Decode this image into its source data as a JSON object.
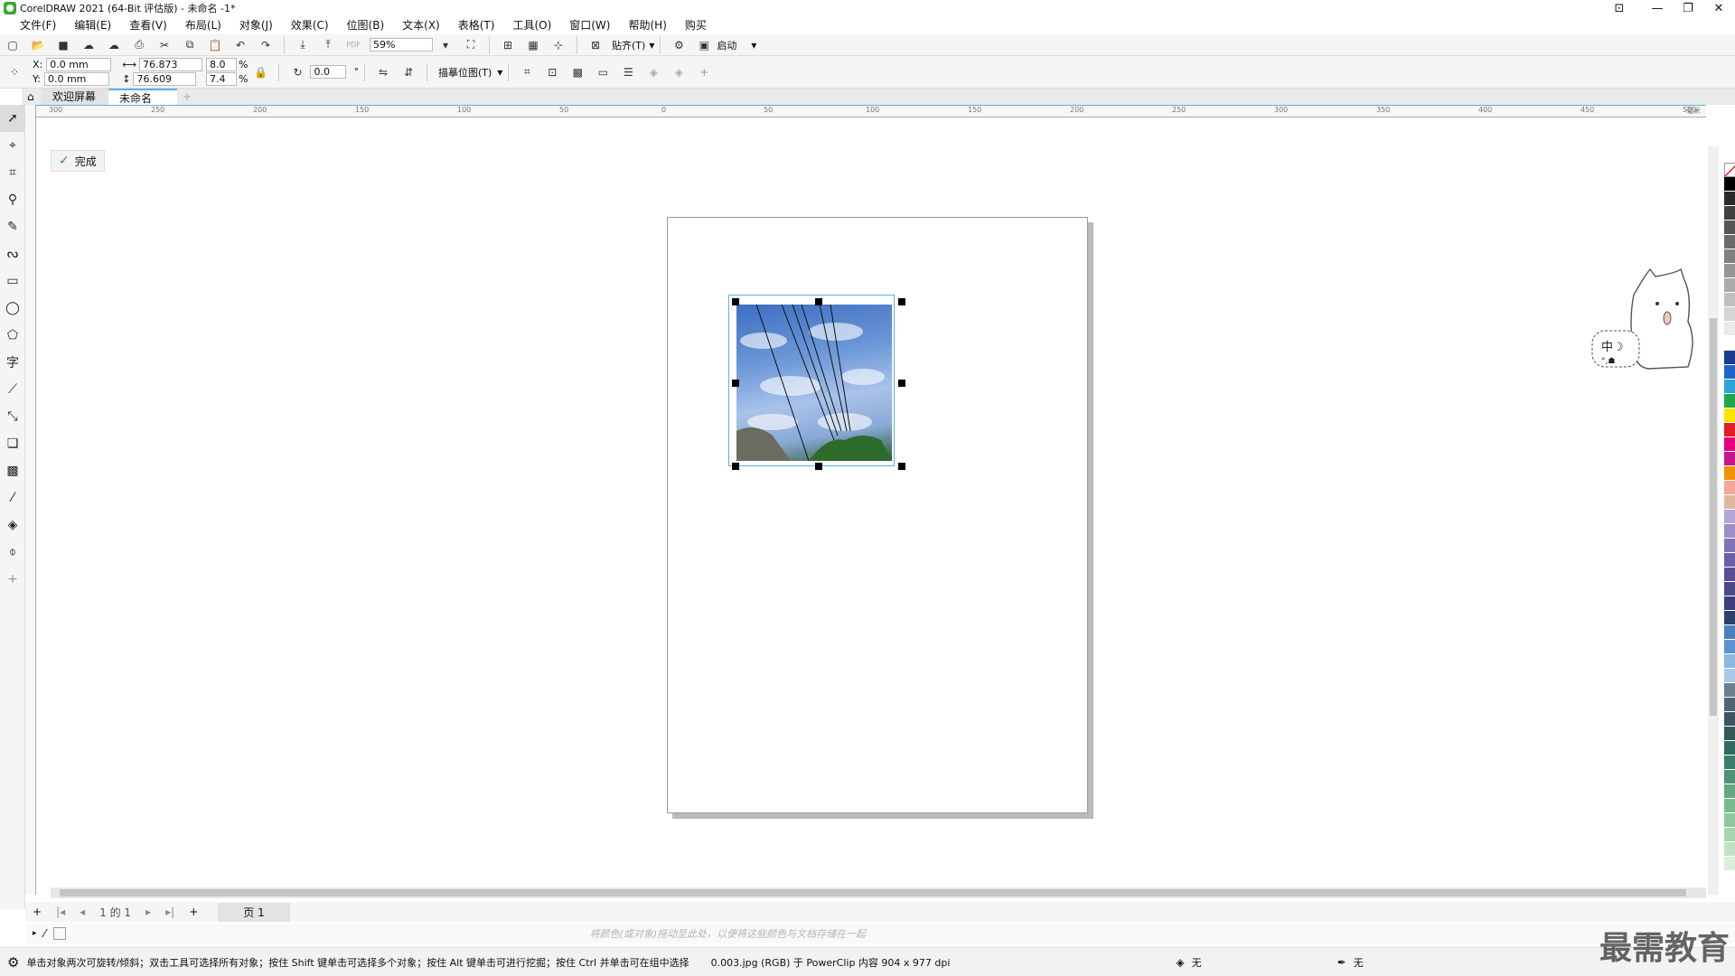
{
  "window": {
    "title": "CorelDRAW 2021 (64-Bit 评估版) - 未命名 -1*"
  },
  "menu": [
    "文件(F)",
    "编辑(E)",
    "查看(V)",
    "布局(L)",
    "对象(J)",
    "效果(C)",
    "位图(B)",
    "文本(X)",
    "表格(T)",
    "工具(O)",
    "窗口(W)",
    "帮助(H)",
    "购买"
  ],
  "standard": {
    "zoom": "59%",
    "snap_label": "贴齐(T)",
    "launch_label": "启动"
  },
  "props": {
    "x_label": "X:",
    "y_label": "Y:",
    "x": "0.0 mm",
    "y": "0.0 mm",
    "width": "76.873 mm",
    "height": "76.609 mm",
    "scale_w": "8.0",
    "scale_h": "7.4",
    "percent": "%",
    "rotation": "0.0",
    "degree": "°",
    "trace_label": "描摹位图(T)"
  },
  "tabs": {
    "home": "欢迎屏幕",
    "doc": "未命名 -1*",
    "add": "+"
  },
  "hruler": [
    "300",
    "250",
    "200",
    "150",
    "100",
    "50",
    "0",
    "50",
    "100",
    "150",
    "200",
    "250",
    "300",
    "350",
    "400",
    "450",
    "500"
  ],
  "hruler_unit": "毫米",
  "done_label": "完成",
  "pagenav": {
    "of": "1 的 1",
    "page_tab": "页 1"
  },
  "colorbar_hint": "将颜色(或对象)拖动至此处，以便将这些颜色与文档存储在一起",
  "status": {
    "hint": "单击对象两次可旋转/倾斜；双击工具可选择所有对象；按住 Shift 键单击可选择多个对象；按住 Alt 键单击可进行挖掘；按住 Ctrl 并单击可在组中选择",
    "info": "0.003.jpg (RGB) 于 PowerClip 内容 904 x 977 dpi",
    "fill": "无",
    "outline": "无"
  },
  "watermark": "最需教育",
  "palette": [
    "#000000",
    "#2b2b2b",
    "#404040",
    "#555555",
    "#6b6b6b",
    "#808080",
    "#959595",
    "#aaaaaa",
    "#bfbfbf",
    "#d5d5d5",
    "#eaeaea",
    "#ffffff",
    "#1a3b8f",
    "#1e64c8",
    "#2aa5d8",
    "#1fa54a",
    "#fce300",
    "#e31e24",
    "#e6007e",
    "#c6168d",
    "#f39200",
    "#f7a69a",
    "#e0b8a0",
    "#b3a6d6",
    "#9c8ec8",
    "#7f74b8",
    "#6a5fa8",
    "#574e98",
    "#4a4a8a",
    "#3a3e7a",
    "#2d3f6e",
    "#4b7fbf",
    "#5d93d1",
    "#8bb7e0",
    "#a9c8e8",
    "#6a7f8f",
    "#4f6573",
    "#3d5560",
    "#355a5a",
    "#2f6b5f",
    "#3a7f6a",
    "#4e9474",
    "#62a880",
    "#78bc8e",
    "#8dc89c",
    "#a6d5ae",
    "#c0e2c2",
    "#d9efd8"
  ]
}
